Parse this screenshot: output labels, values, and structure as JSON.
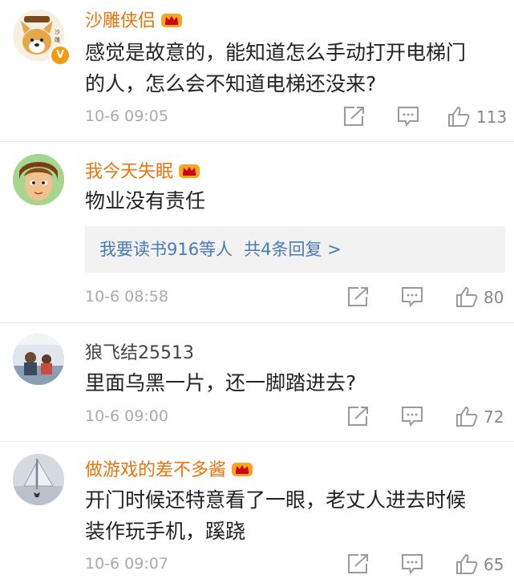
{
  "comments": [
    {
      "username": "沙雕侠侣",
      "text_lines": [
        "感觉是故意的，能知道怎么手动打开电梯门",
        "的人，怎么会不知道电梯还没来?"
      ],
      "time": "10-6 09:05",
      "likes": "113",
      "verified_badge": "V",
      "avatar_icon": "shiba-dog-avatar"
    },
    {
      "username": "我今天失眠",
      "text_lines": [
        "物业没有责任"
      ],
      "reply_preview": {
        "user": "我要读书916等人",
        "count": "共4条回复 >"
      },
      "time": "10-6 08:58",
      "likes": "80",
      "avatar_icon": "cartoon-face-avatar"
    },
    {
      "username": "狼飞结25513",
      "text_lines": [
        "里面乌黑一片，还一脚踏进去?"
      ],
      "time": "10-6 09:00",
      "likes": "72",
      "avatar_icon": "family-photo-avatar"
    },
    {
      "username": "做游戏的差不多酱",
      "text_lines": [
        "开门时候还特意看了一眼，老丈人进去时候",
        "装作玩手机，蹊跷"
      ],
      "time": "10-6 09:07",
      "likes": "65",
      "avatar_icon": "sailboat-photo-avatar"
    }
  ],
  "colors": {
    "vip_name": "#e8740c",
    "reply_link": "#4a79b6",
    "meta": "#aaaaaa"
  },
  "icons": {
    "share": "share-icon",
    "comment": "comment-icon",
    "like": "thumbs-up-icon",
    "vip": "vip-crown-icon"
  }
}
